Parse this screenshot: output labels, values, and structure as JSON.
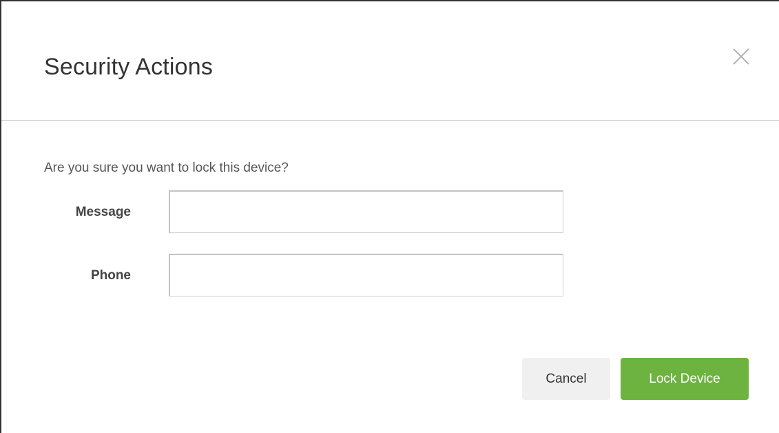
{
  "dialog": {
    "title": "Security Actions",
    "close_icon": "close-icon",
    "prompt": "Are you sure you want to lock this device?"
  },
  "form": {
    "message": {
      "label": "Message",
      "value": "",
      "placeholder": ""
    },
    "phone": {
      "label": "Phone",
      "value": "",
      "placeholder": ""
    }
  },
  "actions": {
    "cancel_label": "Cancel",
    "lock_label": "Lock Device"
  },
  "colors": {
    "primary_button": "#6db33f",
    "secondary_button": "#f0f0f0",
    "title_text": "#333333"
  }
}
